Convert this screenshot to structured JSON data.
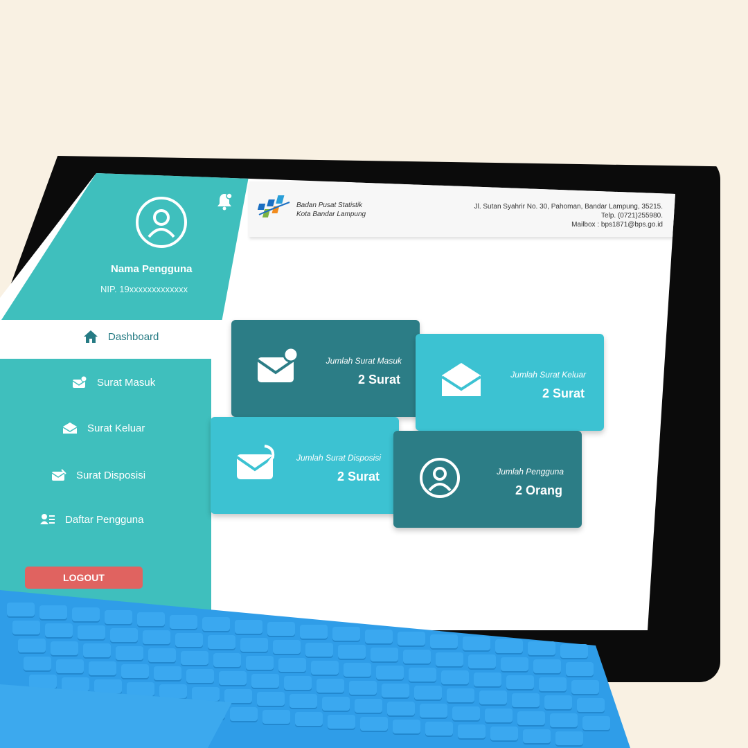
{
  "sidebar": {
    "user_name": "Nama Pengguna",
    "user_nip": "NIP. 19xxxxxxxxxxxxx",
    "items": [
      {
        "label": "Dashboard",
        "icon": "home-icon"
      },
      {
        "label": "Surat Masuk",
        "icon": "mail-in-icon"
      },
      {
        "label": "Surat Keluar",
        "icon": "mail-out-icon"
      },
      {
        "label": "Surat Disposisi",
        "icon": "mail-disposition-icon"
      },
      {
        "label": "Daftar Pengguna",
        "icon": "user-list-icon"
      }
    ],
    "logout_label": "LOGOUT"
  },
  "header": {
    "org_line1": "Badan Pusat Statistik",
    "org_line2": "Kota Bandar Lampung",
    "address_line1": "Jl. Sutan Syahrir No. 30, Pahoman, Bandar Lampung, 35215.",
    "address_line2": "Telp. (0721)255980.",
    "address_line3": "Mailbox : bps1871@bps.go.id"
  },
  "cards": [
    {
      "label": "Jumlah Surat Masuk",
      "value": "2 Surat",
      "icon": "mail-in-icon"
    },
    {
      "label": "Jumlah Surat Keluar",
      "value": "2 Surat",
      "icon": "mail-out-icon"
    },
    {
      "label": "Jumlah Surat Disposisi",
      "value": "2 Surat",
      "icon": "mail-disposition-icon"
    },
    {
      "label": "Jumlah Pengguna",
      "value": "2 Orang",
      "icon": "user-icon"
    }
  ],
  "colors": {
    "sidebar": "#3fbfbd",
    "card_dark": "#2c7d86",
    "card_light": "#3cc2d2",
    "logout": "#e06360",
    "keyboard": "#2f9de8",
    "background": "#f9f1e3"
  }
}
